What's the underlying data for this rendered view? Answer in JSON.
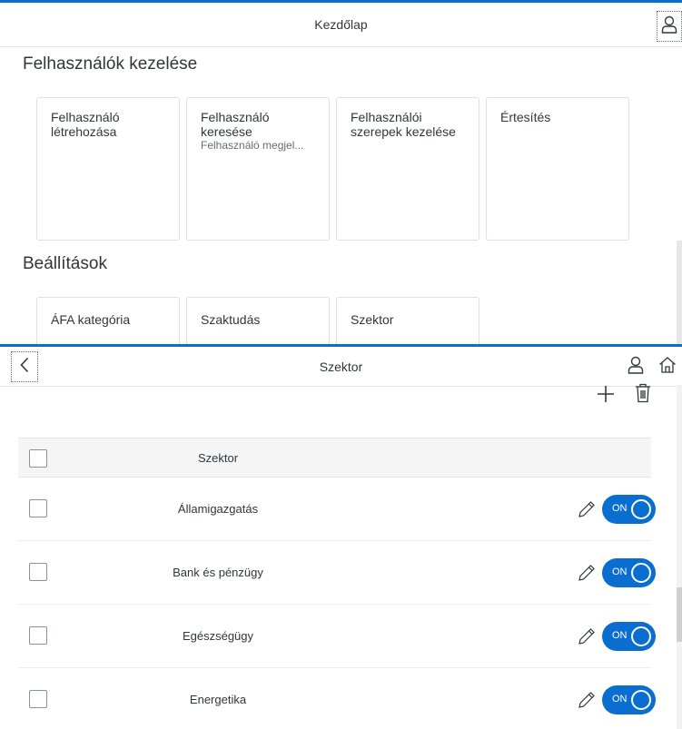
{
  "home": {
    "header": {
      "title": "Kezdőlap"
    },
    "sections": [
      {
        "title": "Felhasználók kezelése",
        "tiles": [
          {
            "title": "Felhasználó létrehozása",
            "subtitle": ""
          },
          {
            "title": "Felhasználó keresése",
            "subtitle": "Felhasználó megjel..."
          },
          {
            "title": "Felhasználói szerepek kezelése",
            "subtitle": ""
          },
          {
            "title": "Értesítés",
            "subtitle": ""
          }
        ]
      },
      {
        "title": "Beállítások",
        "tiles": [
          {
            "title": "ÁFA kategória"
          },
          {
            "title": "Szaktudás"
          },
          {
            "title": "Szektor"
          }
        ]
      }
    ]
  },
  "sector": {
    "header": {
      "title": "Szektor"
    },
    "table": {
      "column_header": "Szektor",
      "rows": [
        {
          "name": "Államigazgatás",
          "status": "ON"
        },
        {
          "name": "Bank és pénzügy",
          "status": "ON"
        },
        {
          "name": "Egészségügy",
          "status": "ON"
        },
        {
          "name": "Energetika",
          "status": "ON"
        }
      ]
    }
  },
  "icons": {
    "user": "user-icon",
    "back": "chevron-left-icon",
    "home": "home-icon",
    "add": "plus-icon",
    "delete": "trash-icon",
    "edit": "pencil-icon"
  },
  "colors": {
    "accent": "#0a6ed1",
    "text": "#32363a",
    "subtext": "#6a6d70",
    "tile_border": "#e0e0e0",
    "table_header_bg": "#f5f5f5"
  }
}
